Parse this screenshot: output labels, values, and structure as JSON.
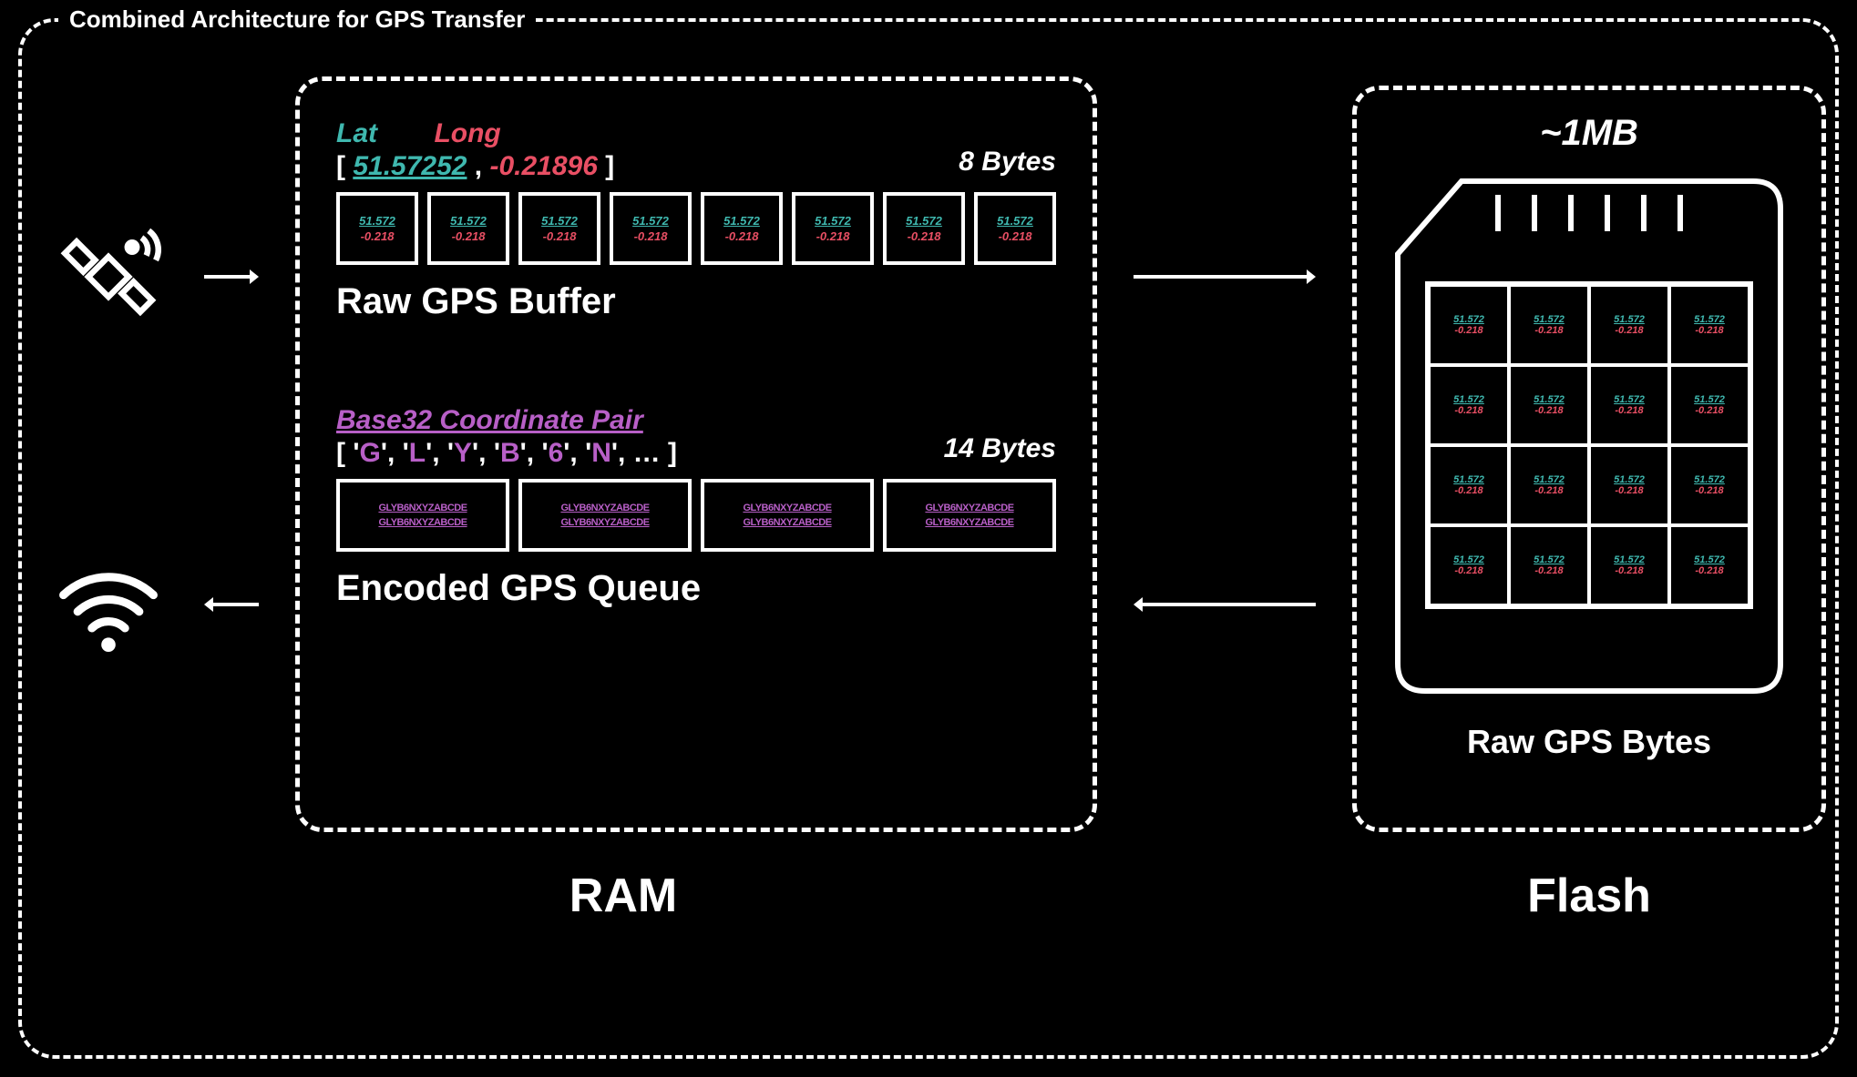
{
  "frame_title": "Combined Architecture for GPS Transfer",
  "ram": {
    "title": "RAM",
    "lat_label": "Lat",
    "long_label": "Long",
    "lat_value": "51.57252",
    "long_value": "-0.21896",
    "raw_size": "8 Bytes",
    "raw_buffer_label": "Raw GPS Buffer",
    "mini_lat": "51.572",
    "mini_long": "-0.218",
    "b32_title": "Base32 Coordinate Pair",
    "b32_chars": [
      "G",
      "L",
      "Y",
      "B",
      "6",
      "N"
    ],
    "b32_ellipsis": "…",
    "enc_size": "14 Bytes",
    "enc_queue_label": "Encoded GPS Queue",
    "enc_mini": "GLYB6NXYZABCDE"
  },
  "flash": {
    "title": "Flash",
    "size": "~1MB",
    "bytes_label": "Raw GPS Bytes",
    "mini_lat": "51.572",
    "mini_long": "-0.218"
  },
  "raw_cells": 8,
  "enc_cells": 4,
  "sd_rows": 4,
  "sd_cols": 4
}
